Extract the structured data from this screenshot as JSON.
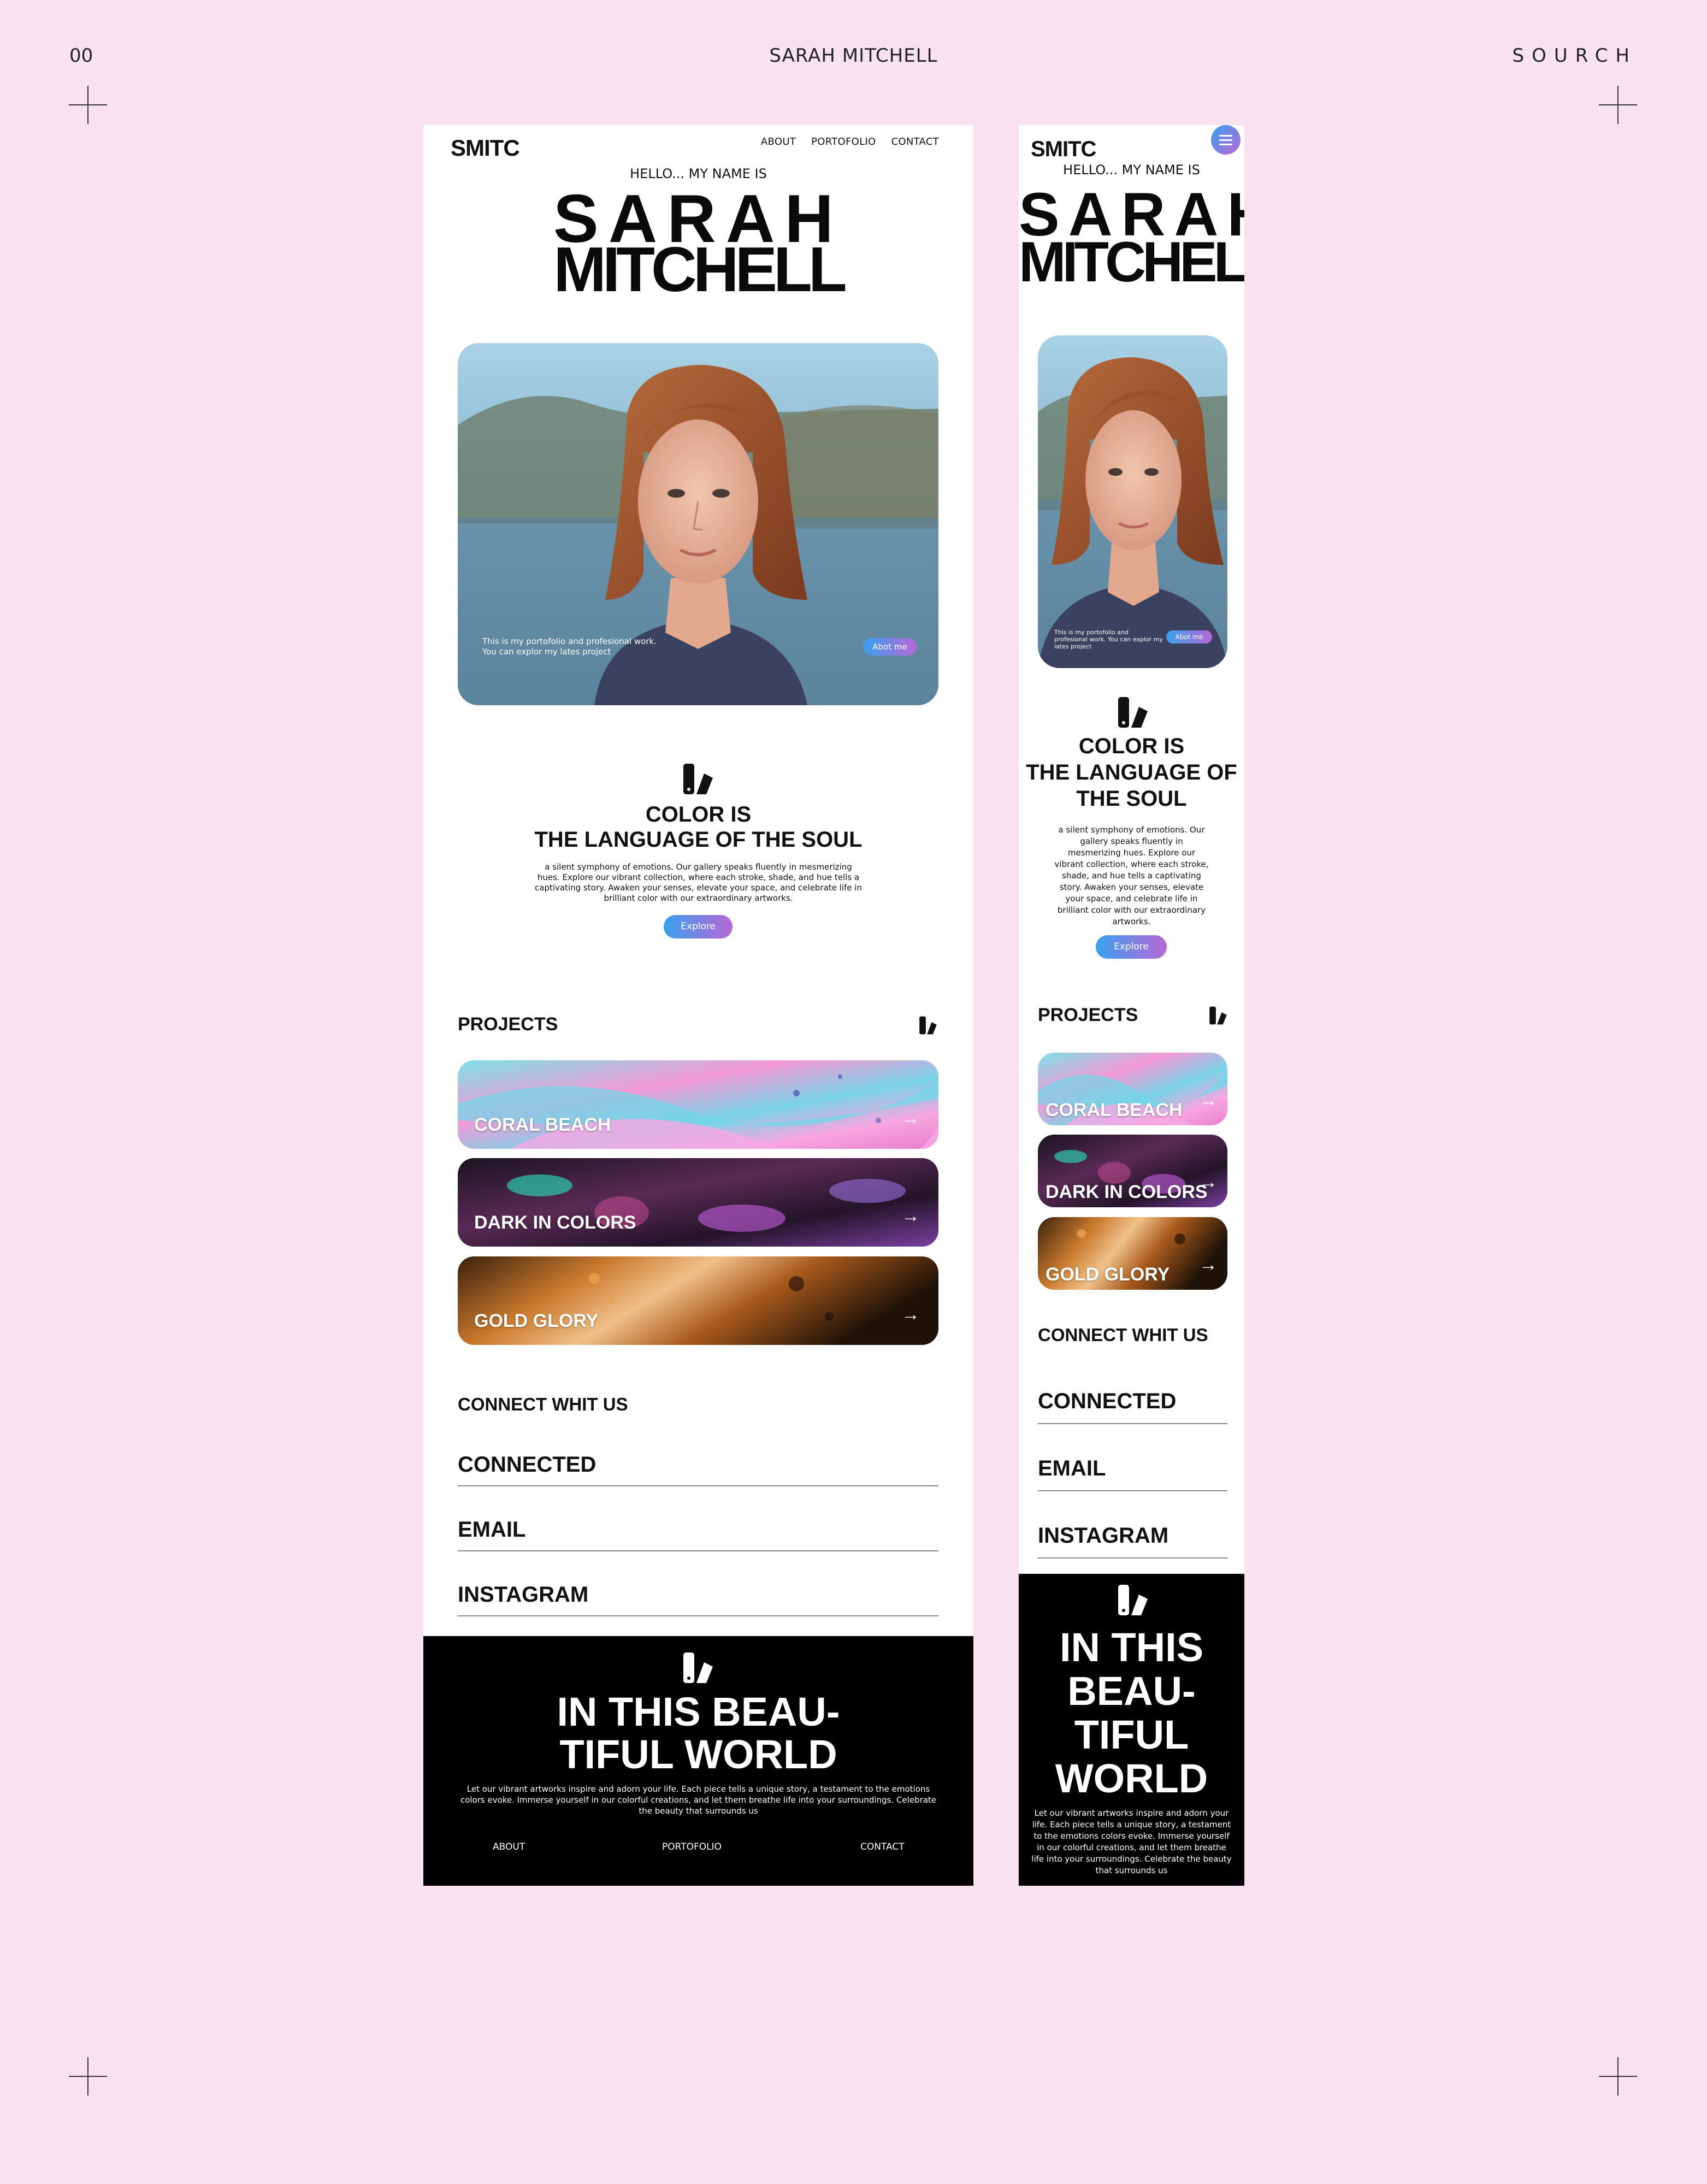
{
  "sheet": {
    "number": "00",
    "title": "SARAH MITCHELL",
    "brand": "SOURCH"
  },
  "site": {
    "logo": "SMITC",
    "nav": [
      "ABOUT",
      "PORTOFOLIO",
      "CONTACT"
    ],
    "hello": "HELLO... MY NAME IS",
    "first_name": "SARAH",
    "last_name": "MITCHELL",
    "photo_caption": "This is my portofolio and profesional work. You can explor my lates project",
    "about_button": "Abot me",
    "color_title_1": "COLOR IS",
    "color_title_2": "THE LANGUAGE OF THE SOUL",
    "color_text": "a silent symphony of emotions. Our gallery speaks fluently in mesmerizing hues. Explore our vibrant collection, where each stroke, shade, and hue tells a captivating story. Awaken your senses, elevate your space, and celebrate life in brilliant color with our extraordinary artworks.",
    "explore_button": "Explore",
    "projects_title": "PROJECTS",
    "projects": [
      {
        "label": "CORAL BEACH"
      },
      {
        "label": "DARK IN COLORS"
      },
      {
        "label": "GOLD GLORY"
      }
    ],
    "connect_title": "CONNECT WHIT US",
    "links": [
      "CONNECTED",
      "EMAIL",
      "INSTAGRAM"
    ],
    "footer_title_desktop_1": "IN THIS BEAU-",
    "footer_title_desktop_2": "TIFUL WORLD",
    "footer_title_mobile": [
      "IN THIS",
      "BEAU-",
      "TIFUL",
      "WORLD"
    ],
    "footer_text": "Let our vibrant artworks inspire and adorn your life. Each piece tells a unique story, a testament to the emotions colors evoke. Immerse yourself in our colorful creations, and let them breathe life into your surroundings. Celebrate the beauty that surrounds us",
    "footer_nav": [
      "ABOUT",
      "PORTOFOLIO",
      "CONTACT"
    ]
  },
  "colors": {
    "background": "#f8e2ef",
    "gradient_start": "#3aa0ee",
    "gradient_end": "#b768d6",
    "footer": "#000000"
  }
}
